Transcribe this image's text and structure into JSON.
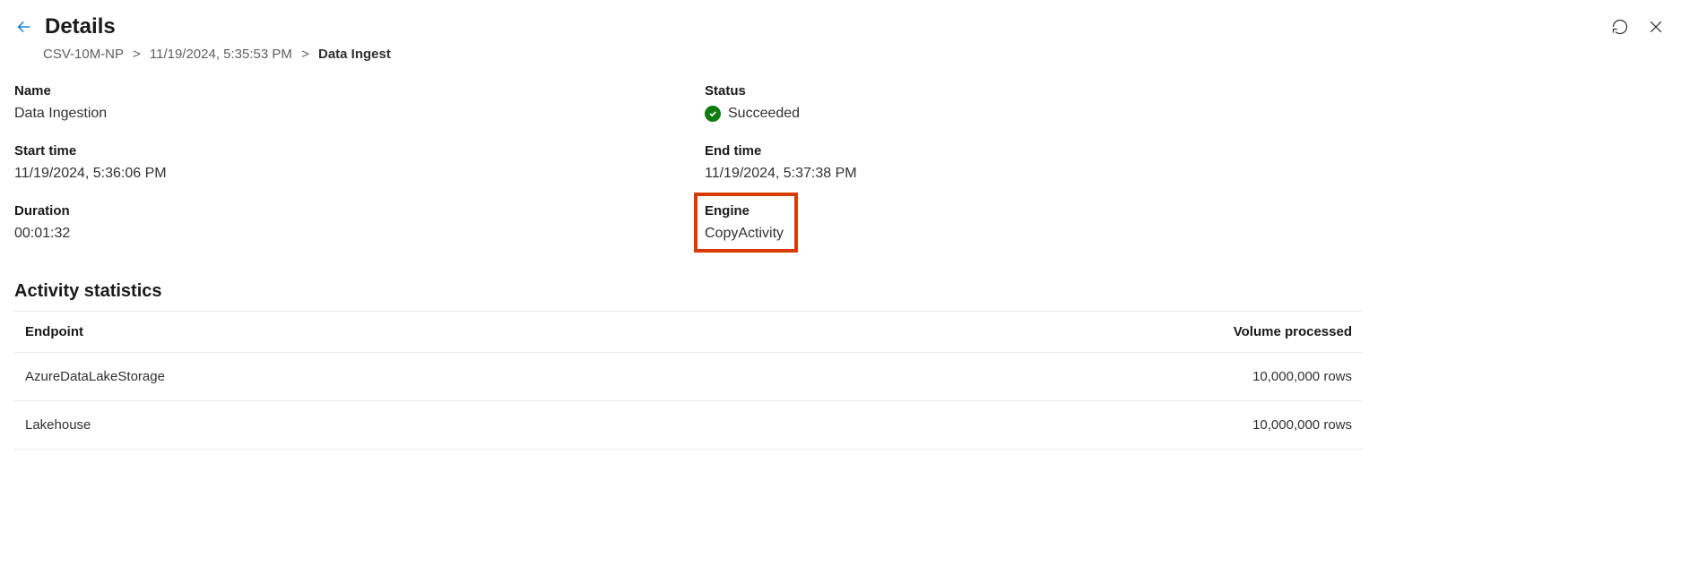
{
  "header": {
    "title": "Details"
  },
  "breadcrumb": {
    "item0": "CSV-10M-NP",
    "item1": "11/19/2024, 5:35:53 PM",
    "current": "Data Ingest"
  },
  "fields": {
    "name_label": "Name",
    "name_value": "Data Ingestion",
    "status_label": "Status",
    "status_value": "Succeeded",
    "start_label": "Start time",
    "start_value": "11/19/2024, 5:36:06 PM",
    "end_label": "End time",
    "end_value": "11/19/2024, 5:37:38 PM",
    "duration_label": "Duration",
    "duration_value": "00:01:32",
    "engine_label": "Engine",
    "engine_value": "CopyActivity"
  },
  "activity": {
    "section_title": "Activity statistics",
    "col_endpoint": "Endpoint",
    "col_volume": "Volume processed",
    "rows": [
      {
        "endpoint": "AzureDataLakeStorage",
        "volume": "10,000,000 rows"
      },
      {
        "endpoint": "Lakehouse",
        "volume": "10,000,000 rows"
      }
    ]
  }
}
